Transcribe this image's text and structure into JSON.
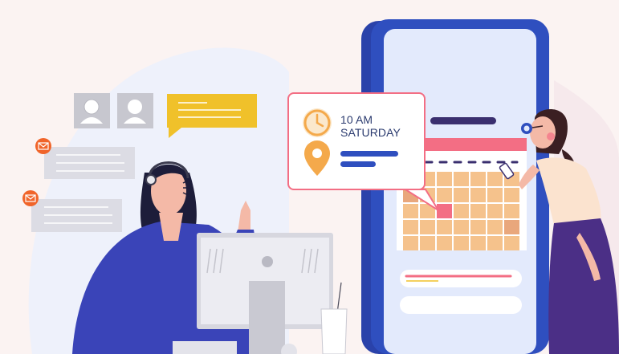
{
  "appointment": {
    "time": "10 AM",
    "day": "SATURDAY"
  },
  "icons": [
    "mail-icon",
    "clock-icon",
    "location-pin-icon",
    "calendar-icon",
    "headset-icon",
    "user-avatar-icon",
    "chat-bubble-icon",
    "phone-icon",
    "desktop-monitor-icon"
  ],
  "colors": {
    "phone_frame": "#2f4fbf",
    "phone_screen": "#e3eafc",
    "accent_pink": "#f36e84",
    "calendar_cell": "#f5c28c",
    "chat_yellow": "#f0c12a",
    "mail_orange": "#f0642a",
    "agent_shirt": "#3a44b8",
    "woman_skirt": "#4b2f86",
    "text_navy": "#2b3b6f"
  }
}
